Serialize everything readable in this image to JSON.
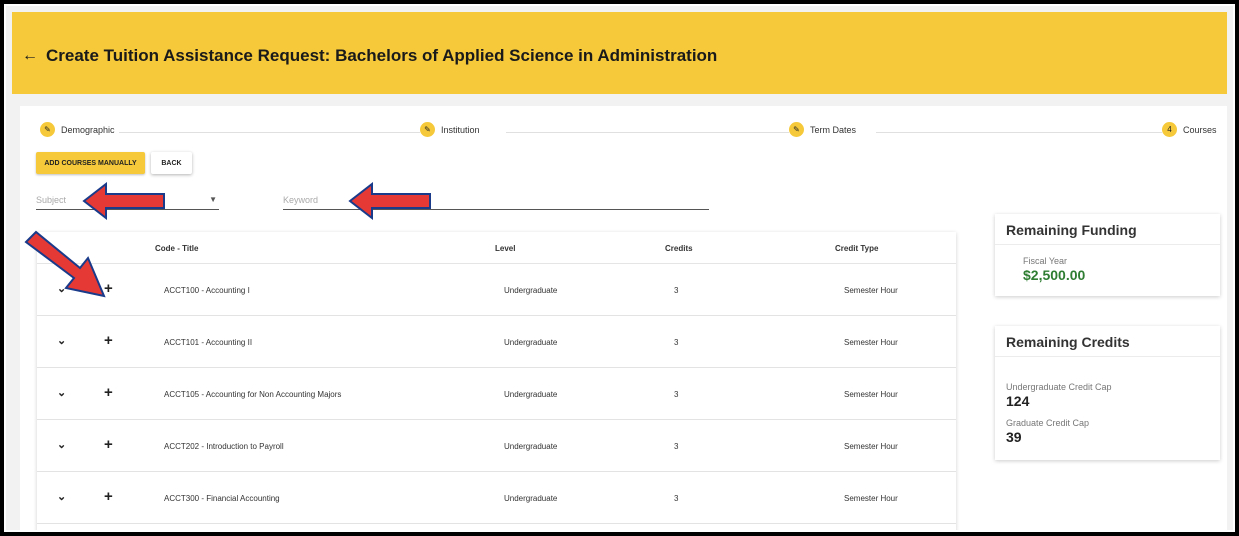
{
  "header": {
    "back_icon": "arrow-left-icon",
    "title": "Create Tuition Assistance Request: Bachelors of Applied Science in Administration"
  },
  "stepper": {
    "steps": [
      {
        "label": "Demographic",
        "icon": "pencil-icon"
      },
      {
        "label": "Institution",
        "icon": "pencil-icon"
      },
      {
        "label": "Term Dates",
        "icon": "pencil-icon"
      },
      {
        "label": "Courses",
        "number": "4"
      }
    ]
  },
  "actions": {
    "add_manually": "ADD COURSES MANUALLY",
    "back": "BACK"
  },
  "filters": {
    "subject_placeholder": "Subject",
    "keyword_placeholder": "Keyword"
  },
  "table": {
    "headers": {
      "code_title": "Code - Title",
      "level": "Level",
      "credits": "Credits",
      "credit_type": "Credit Type"
    },
    "rows": [
      {
        "code_title": "ACCT100 - Accounting I",
        "level": "Undergraduate",
        "credits": "3",
        "credit_type": "Semester Hour"
      },
      {
        "code_title": "ACCT101 - Accounting II",
        "level": "Undergraduate",
        "credits": "3",
        "credit_type": "Semester Hour"
      },
      {
        "code_title": "ACCT105 - Accounting for Non Accounting Majors",
        "level": "Undergraduate",
        "credits": "3",
        "credit_type": "Semester Hour"
      },
      {
        "code_title": "ACCT202 - Introduction to Payroll",
        "level": "Undergraduate",
        "credits": "3",
        "credit_type": "Semester Hour"
      },
      {
        "code_title": "ACCT300 - Financial Accounting",
        "level": "Undergraduate",
        "credits": "3",
        "credit_type": "Semester Hour"
      }
    ]
  },
  "funding": {
    "title": "Remaining Funding",
    "label": "Fiscal Year",
    "amount": "$2,500.00"
  },
  "credits": {
    "title": "Remaining Credits",
    "undergrad_label": "Undergraduate Credit Cap",
    "undergrad_value": "124",
    "grad_label": "Graduate Credit Cap",
    "grad_value": "39"
  },
  "colors": {
    "accent": "#f5c93a",
    "annotation_arrow": "#e53935",
    "money": "#2e7d32"
  }
}
